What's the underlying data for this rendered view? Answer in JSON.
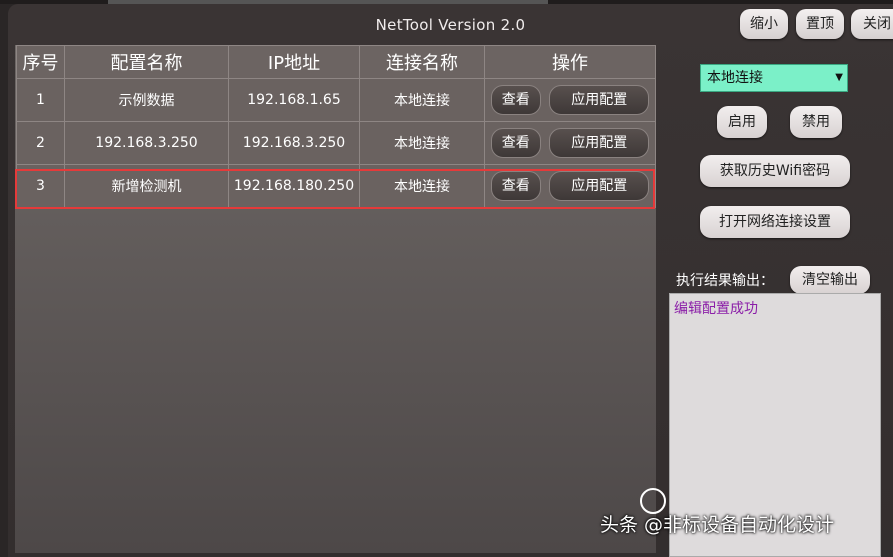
{
  "window": {
    "title": "NetTool Version 2.0",
    "minimize_label": "缩小",
    "pin_label": "置顶",
    "close_label": "关闭"
  },
  "table": {
    "headers": [
      "序号",
      "配置名称",
      "IP地址",
      "连接名称",
      "操作"
    ],
    "rows": [
      {
        "index": "1",
        "name": "示例数据",
        "ip": "192.168.1.65",
        "conn": "本地连接",
        "view": "查看",
        "apply": "应用配置"
      },
      {
        "index": "2",
        "name": "192.168.3.250",
        "ip": "192.168.3.250",
        "conn": "本地连接",
        "view": "查看",
        "apply": "应用配置"
      },
      {
        "index": "3",
        "name": "新增检测机",
        "ip": "192.168.180.250",
        "conn": "本地连接",
        "view": "查看",
        "apply": "应用配置"
      }
    ]
  },
  "side": {
    "adapter_select": "本地连接",
    "enable_label": "启用",
    "disable_label": "禁用",
    "wifi_label": "获取历史Wifi密码",
    "netsettings_label": "打开网络连接设置",
    "output_label": "执行结果输出：",
    "clear_label": "清空输出",
    "output_text": "编辑配置成功"
  },
  "watermark": "头条 @非标设备自动化设计",
  "colors": {
    "dropdown_bg": "#7bf0c8",
    "selection_border": "#e53a3a",
    "output_text": "#8b1ea8"
  }
}
